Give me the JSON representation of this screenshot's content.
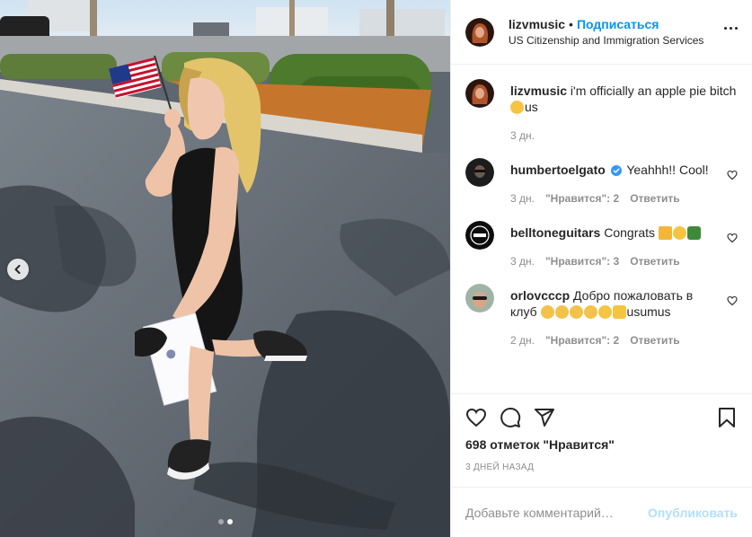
{
  "header": {
    "username": "lizvmusic",
    "separator": "•",
    "follow_label": "Подписаться",
    "location": "US Citizenship and Immigration Services"
  },
  "caption": {
    "username": "lizvmusic",
    "text": "i'm officially an apple pie bitch",
    "suffix": "us",
    "time": "3 дн."
  },
  "comments": [
    {
      "username": "humbertoelgato",
      "verified": true,
      "text": "Yeahhh!! Cool!",
      "time": "3 дн.",
      "likes": "\"Нравится\": 2",
      "reply": "Ответить"
    },
    {
      "username": "belltoneguitars",
      "verified": false,
      "text": "Congrats",
      "time": "3 дн.",
      "likes": "\"Нравится\": 3",
      "reply": "Ответить"
    },
    {
      "username": "orlovcccp",
      "verified": false,
      "text": "Добро пожаловать в клуб",
      "suffix": "usumus",
      "time": "2 дн.",
      "likes": "\"Нравится\": 2",
      "reply": "Ответить"
    }
  ],
  "actions": {
    "likes_count": "698 отметок \"Нравится\"",
    "date": "3 ДНЕЙ НАЗАД"
  },
  "add_comment": {
    "placeholder": "Добавьте комментарий…",
    "post_label": "Опубликовать"
  },
  "carousel": {
    "current": 2,
    "total": 2
  },
  "colors": {
    "accent": "#0095f6",
    "text": "#262626",
    "muted": "#8e8e8e",
    "post_disabled": "#b2dffc",
    "border": "#efefef"
  }
}
